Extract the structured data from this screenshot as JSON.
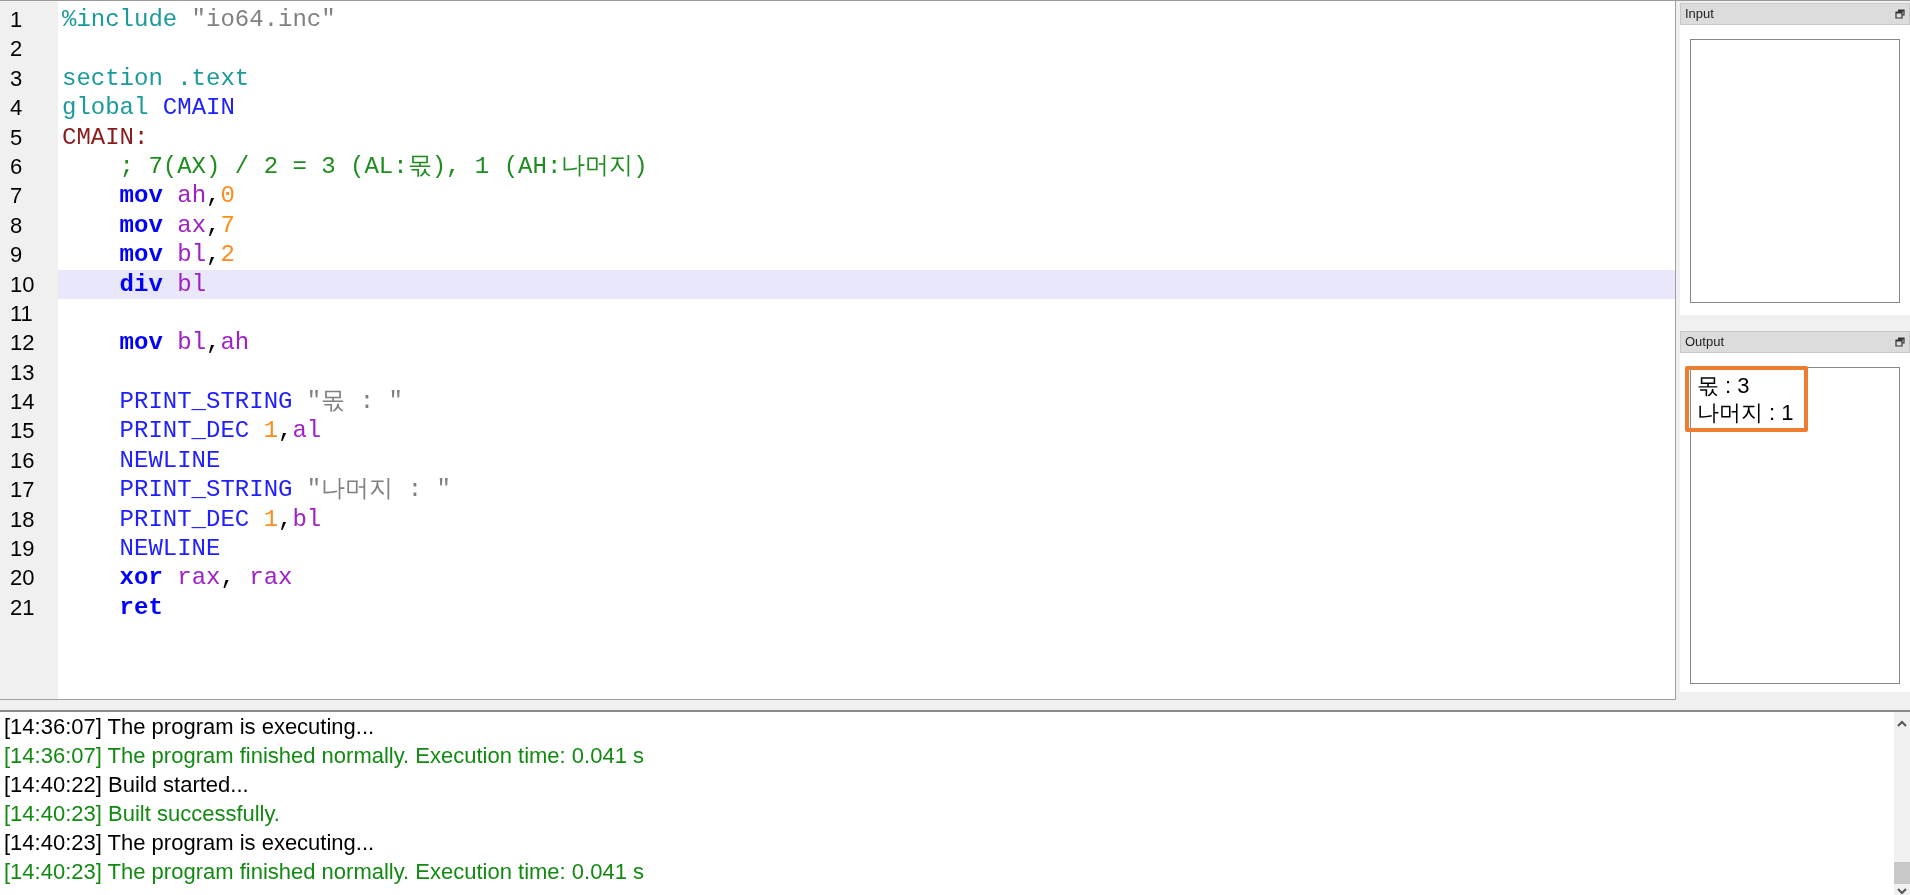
{
  "editor": {
    "lines": [
      {
        "number": "1",
        "current": false,
        "tokens": [
          {
            "kind": "directive",
            "text": "%include"
          },
          {
            "kind": "string",
            "text": " \"io64.inc\""
          }
        ]
      },
      {
        "number": "2",
        "current": false
      },
      {
        "number": "3",
        "current": false,
        "tokens": [
          {
            "kind": "directive",
            "text": "section .text"
          }
        ]
      },
      {
        "number": "4",
        "current": false,
        "tokens": [
          {
            "kind": "directive",
            "text": "global "
          },
          {
            "kind": "macro",
            "text": "CMAIN"
          }
        ]
      },
      {
        "number": "5",
        "current": false,
        "tokens": [
          {
            "kind": "label",
            "text": "CMAIN:"
          }
        ]
      },
      {
        "number": "6",
        "current": false,
        "tokens": [
          {
            "kind": "comment",
            "text": "    ; 7(AX) / 2 = 3 (AL:몫), 1 (AH:나머지)"
          }
        ]
      },
      {
        "number": "7",
        "current": false,
        "tokens": [
          {
            "kind": "keyword",
            "text": "    mov"
          },
          {
            "kind": "register",
            "text": " ah"
          },
          {
            "kind": "plain",
            "text": ","
          },
          {
            "kind": "number",
            "text": "0"
          }
        ]
      },
      {
        "number": "8",
        "current": false,
        "tokens": [
          {
            "kind": "keyword",
            "text": "    mov"
          },
          {
            "kind": "register",
            "text": " ax"
          },
          {
            "kind": "plain",
            "text": ","
          },
          {
            "kind": "number",
            "text": "7"
          }
        ]
      },
      {
        "number": "9",
        "current": false,
        "tokens": [
          {
            "kind": "keyword",
            "text": "    mov"
          },
          {
            "kind": "register",
            "text": " bl"
          },
          {
            "kind": "plain",
            "text": ","
          },
          {
            "kind": "number",
            "text": "2"
          }
        ]
      },
      {
        "number": "10",
        "current": true,
        "tokens": [
          {
            "kind": "keyword",
            "text": "    div"
          },
          {
            "kind": "register",
            "text": " bl"
          }
        ]
      },
      {
        "number": "11",
        "current": false
      },
      {
        "number": "12",
        "current": false,
        "tokens": [
          {
            "kind": "keyword",
            "text": "    mov"
          },
          {
            "kind": "register",
            "text": " bl"
          },
          {
            "kind": "plain",
            "text": ","
          },
          {
            "kind": "register",
            "text": "ah"
          }
        ]
      },
      {
        "number": "13",
        "current": false
      },
      {
        "number": "14",
        "current": false,
        "tokens": [
          {
            "kind": "macro",
            "text": "    PRINT_STRING"
          },
          {
            "kind": "string",
            "text": " \"몫 : \""
          }
        ]
      },
      {
        "number": "15",
        "current": false,
        "tokens": [
          {
            "kind": "macro",
            "text": "    PRINT_DEC"
          },
          {
            "kind": "number",
            "text": " 1"
          },
          {
            "kind": "plain",
            "text": ","
          },
          {
            "kind": "register",
            "text": "al"
          }
        ]
      },
      {
        "number": "16",
        "current": false,
        "tokens": [
          {
            "kind": "macro",
            "text": "    NEWLINE"
          }
        ]
      },
      {
        "number": "17",
        "current": false,
        "tokens": [
          {
            "kind": "macro",
            "text": "    PRINT_STRING"
          },
          {
            "kind": "string",
            "text": " \"나머지 : \""
          }
        ]
      },
      {
        "number": "18",
        "current": false,
        "tokens": [
          {
            "kind": "macro",
            "text": "    PRINT_DEC"
          },
          {
            "kind": "number",
            "text": " 1"
          },
          {
            "kind": "plain",
            "text": ","
          },
          {
            "kind": "register",
            "text": "bl"
          }
        ]
      },
      {
        "number": "19",
        "current": false,
        "tokens": [
          {
            "kind": "macro",
            "text": "    NEWLINE"
          }
        ]
      },
      {
        "number": "20",
        "current": false,
        "tokens": [
          {
            "kind": "keyword",
            "text": "    xor"
          },
          {
            "kind": "register",
            "text": " rax"
          },
          {
            "kind": "plain",
            "text": ","
          },
          {
            "kind": "register",
            "text": " rax"
          }
        ]
      },
      {
        "number": "21",
        "current": false,
        "tokens": [
          {
            "kind": "keyword",
            "text": "    ret"
          }
        ]
      }
    ]
  },
  "input_panel": {
    "title": "Input"
  },
  "output_panel": {
    "title": "Output",
    "annotated": true,
    "lines": [
      "몫 : 3",
      "나머지 : 1"
    ]
  },
  "log": [
    {
      "kind": "info",
      "time": "[14:36:07]",
      "message": "The program is executing..."
    },
    {
      "kind": "success",
      "time": "[14:36:07]",
      "message": "The program finished normally. Execution time: 0.041 s"
    },
    {
      "kind": "info",
      "time": "[14:40:22]",
      "message": "Build started..."
    },
    {
      "kind": "success",
      "time": "[14:40:23]",
      "message": "Built successfully."
    },
    {
      "kind": "info",
      "time": "[14:40:23]",
      "message": "The program is executing..."
    },
    {
      "kind": "success",
      "time": "[14:40:23]",
      "message": "The program finished normally. Execution time: 0.041 s"
    }
  ]
}
